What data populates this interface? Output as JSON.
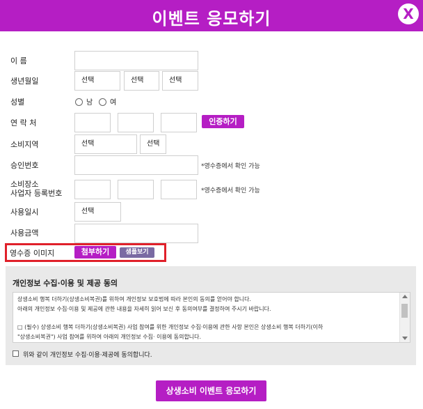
{
  "header": {
    "title": "이벤트 응모하기",
    "close_label": "X"
  },
  "form": {
    "name_label": "이 름",
    "birth_label": "생년월일",
    "birth_year": "선택",
    "birth_month": "선택",
    "birth_day": "선택",
    "gender_label": "성별",
    "gender_male": "남",
    "gender_female": "여",
    "contact_label": "연 락 처",
    "verify_button": "인증하기",
    "region_label": "소비지역",
    "region_city": "선택",
    "region_district": "선택",
    "approval_label": "승인번호",
    "receipt_note": "*영수증에서 확인 가능",
    "store_label_line1": "소비장소",
    "store_label_line2": "사업자 등록번호",
    "use_date_label": "사용일시",
    "use_date_select": "선택",
    "amount_label": "사용금액",
    "receipt_image_label": "영수증 이미지",
    "attach_button": "첨부하기",
    "sample_button": "샘플보기"
  },
  "privacy": {
    "title": "개인정보 수집·이용 및 제공 동의",
    "lines": [
      "상생소비 행복 더하기(상생소비복권)를 위하여 개인정보 보호법에 따라 본인의 동의를 얻어야 합니다.",
      "아래의 개인정보 수집·이용 및 제공에 관한 내용을 자세히 읽어 보신 후 동의여부를 결정하여 주시기 바랍니다.",
      "□ (필수) 상생소비 행복 더하기(상생소비복권) 사업 참여를 위한 개인정보 수집·이용에 관한 사항 본인은 상생소비 행복 더하기(이하",
      "\"상생소비복권\") 사업 참여를 위하여 아래의 개인정보 수집· 이용에 동의합니다."
    ],
    "agree_label": "위와 같이 개인정보 수집·이용·제공에 동의합니다."
  },
  "submit_label": "상생소비 이벤트 응모하기",
  "colors": {
    "brand": "#b51ec4",
    "secondary": "#7a6aa3",
    "highlight": "#e0202a"
  }
}
